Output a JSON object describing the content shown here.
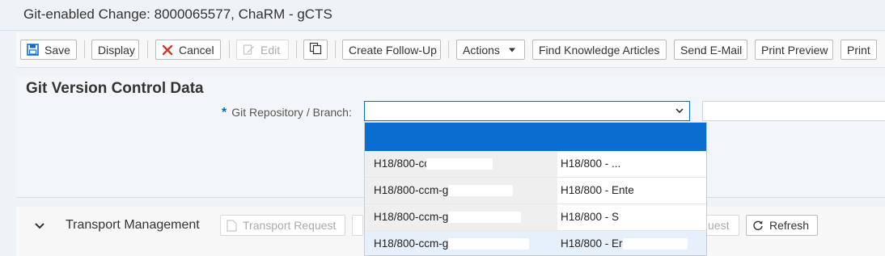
{
  "window": {
    "title": "Git-enabled Change: 8000065577, ChaRM - gCTS"
  },
  "toolbar": {
    "save": "Save",
    "display": "Display",
    "cancel": "Cancel",
    "edit": "Edit",
    "create_followup": "Create Follow-Up",
    "actions": "Actions",
    "find_knowledge": "Find Knowledge Articles",
    "send_email": "Send E-Mail",
    "print_preview": "Print Preview",
    "print": "Print"
  },
  "git_section": {
    "heading": "Git Version Control Data",
    "field_label": "Git Repository / Branch:",
    "required_marker": "*",
    "selected_value": ""
  },
  "dropdown": {
    "rows": [
      {
        "col1": "H18/800-cc",
        "col2": "H18/800 - ..."
      },
      {
        "col1": "H18/800-ccm-g",
        "col2": "H18/800 - Ente"
      },
      {
        "col1": "H18/800-ccm-g",
        "col2": "H18/800 - S"
      },
      {
        "col1": "H18/800-ccm-g",
        "col2": "H18/800 - Er"
      }
    ]
  },
  "transport": {
    "title": "Transport Management",
    "transport_request": "Transport Request",
    "uest_fragment": "uest",
    "refresh": "Refresh"
  },
  "colors": {
    "accent": "#0a6ed1",
    "cancel_red": "#d03a2a"
  }
}
